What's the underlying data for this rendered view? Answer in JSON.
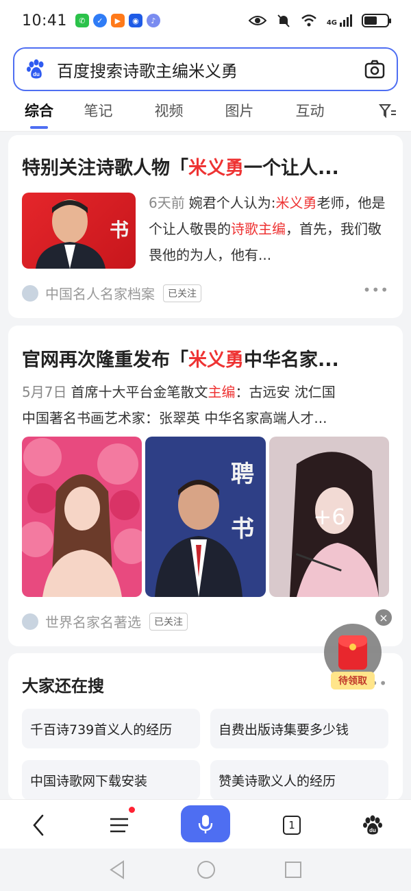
{
  "status_bar": {
    "time": "10:41",
    "network": "4G"
  },
  "search": {
    "query": "百度搜索诗歌主编米义勇"
  },
  "tabs": [
    {
      "label": "综合",
      "active": true
    },
    {
      "label": "笔记"
    },
    {
      "label": "视频"
    },
    {
      "label": "图片"
    },
    {
      "label": "互动"
    }
  ],
  "results": [
    {
      "title_pre": "特别关注诗歌人物「",
      "title_hl": "米义勇",
      "title_post": "一个让人...",
      "date": "6天前",
      "snippet_parts": [
        "婉君个人认为:",
        "米义勇",
        "老师，他是个让人敬畏的",
        "诗歌主编",
        "，首先，我们敬畏他的为人，他有..."
      ],
      "source": "中国名人名家档案",
      "follow_label": "已关注"
    },
    {
      "title_pre": "官网再次隆重发布「",
      "title_hl": "米义勇",
      "title_post": "中华名家...",
      "date": "5月7日",
      "snippet_parts": [
        "首席十大平台金笔散文",
        "主编",
        "：古远安 沈仁国",
        "中国著名书画艺术家：张翠英 中华名家高端人才..."
      ],
      "image_text": {
        "pin": "聘",
        "shu": "书",
        "more": "+6"
      },
      "source": "世界名家名著选",
      "follow_label": "已关注"
    }
  ],
  "related": {
    "title": "大家还在搜",
    "items": [
      "千百诗739首义人的经历",
      "自费出版诗集要多少钱",
      "中国诗歌网下载安装",
      "赞美诗歌义人的经历"
    ]
  },
  "red_packet": {
    "label": "待领取"
  },
  "first_thumb_text": "书",
  "bottom_nav": {
    "tab_count": "1"
  },
  "colors": {
    "accent": "#4e6ef2",
    "highlight": "#e33333"
  }
}
